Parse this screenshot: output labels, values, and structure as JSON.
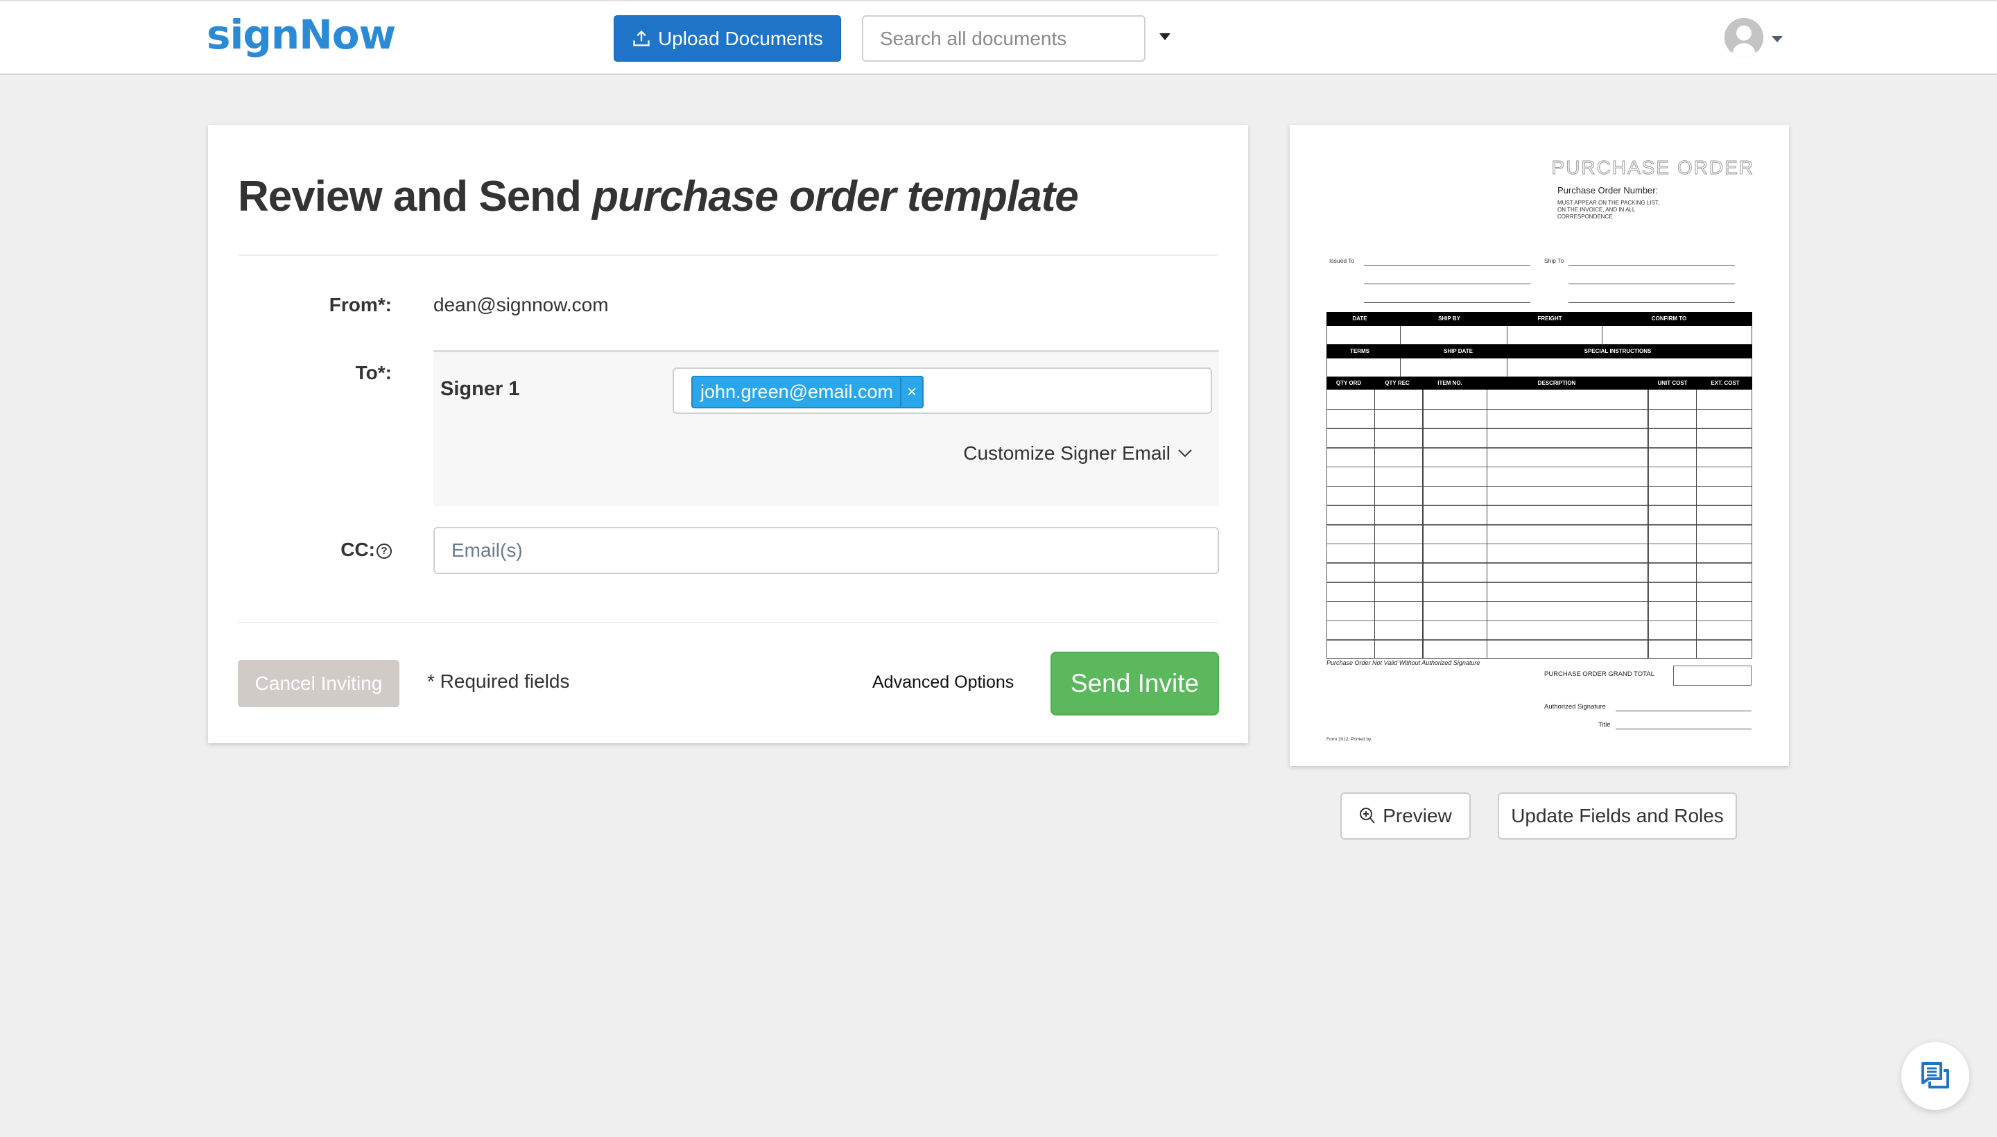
{
  "header": {
    "logo": "signNow",
    "upload_button": "Upload Documents",
    "search_placeholder": "Search all documents",
    "icons": {
      "upload": "upload-icon",
      "search": "search-icon",
      "search_dropdown": "caret-down-icon",
      "avatar": "user-avatar-icon",
      "avatar_dropdown": "caret-down-icon"
    }
  },
  "form": {
    "title_prefix": "Review and Send",
    "document_name": "purchase order template",
    "from_label": "From*:",
    "from_value": "dean@signnow.com",
    "to_label": "To*:",
    "signers": [
      {
        "role": "Signer 1",
        "emails": [
          "john.green@email.com"
        ],
        "remove_label": "×"
      }
    ],
    "customize_label": "Customize Signer Email",
    "cc_label": "CC:",
    "cc_help": "?",
    "cc_placeholder": "Email(s)",
    "cancel_button": "Cancel Inviting",
    "required_note": "* Required fields",
    "advanced_options": "Advanced Options",
    "send_button": "Send Invite",
    "colors": {
      "brand_blue": "#1e74c9",
      "chip_blue": "#29a7ea",
      "send_green": "#5cb85c",
      "cancel_disabled": "#d0cbc7"
    }
  },
  "document_preview": {
    "title": "PURCHASE ORDER",
    "po_number_label": "Purchase Order Number:",
    "po_notice": "MUST APPEAR ON THE PACKING LIST, ON THE  INVOICE, AND IN ALL CORRESPONDENCE.",
    "issued_to": "Issued To",
    "ship_to": "Ship To",
    "header_row_1": [
      "DATE",
      "SHIP BY",
      "FREIGHT",
      "CONFIRM TO"
    ],
    "header_row_2": [
      "TERMS",
      "SHIP DATE",
      "SPECIAL INSTRUCTIONS"
    ],
    "header_row_3": [
      "QTY ORD",
      "QTY REC",
      "ITEM NO.",
      "DESCRIPTION",
      "UNIT COST",
      "EXT. COST"
    ],
    "validity_note": "Purchase Order Not Valid Without Authorized Signature",
    "grand_total_label": "PURCHASE ORDER GRAND TOTAL",
    "authorized_signature_label": "Authorized Signature",
    "title_label": "Title",
    "form_footer": "Form 2012, Printed by:"
  },
  "preview_actions": {
    "preview_button": "Preview",
    "update_button": "Update Fields and Roles"
  },
  "chat": {
    "icon": "chat-icon"
  }
}
